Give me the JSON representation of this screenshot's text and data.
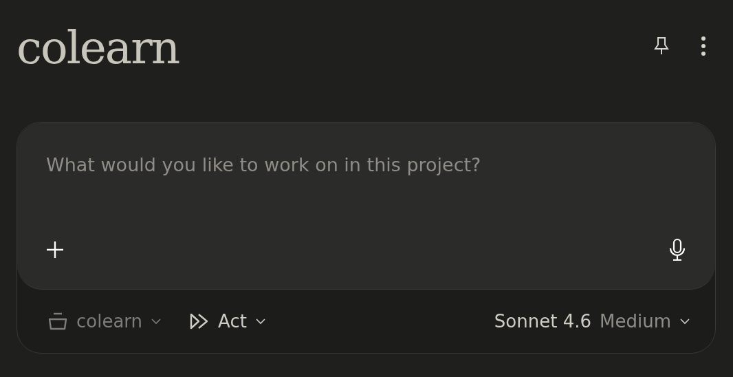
{
  "header": {
    "title": "colearn"
  },
  "composer": {
    "placeholder": "What would you like to work on in this project?"
  },
  "footer": {
    "project": "colearn",
    "mode": "Act",
    "model": "Sonnet 4.6",
    "effort": "Medium"
  }
}
